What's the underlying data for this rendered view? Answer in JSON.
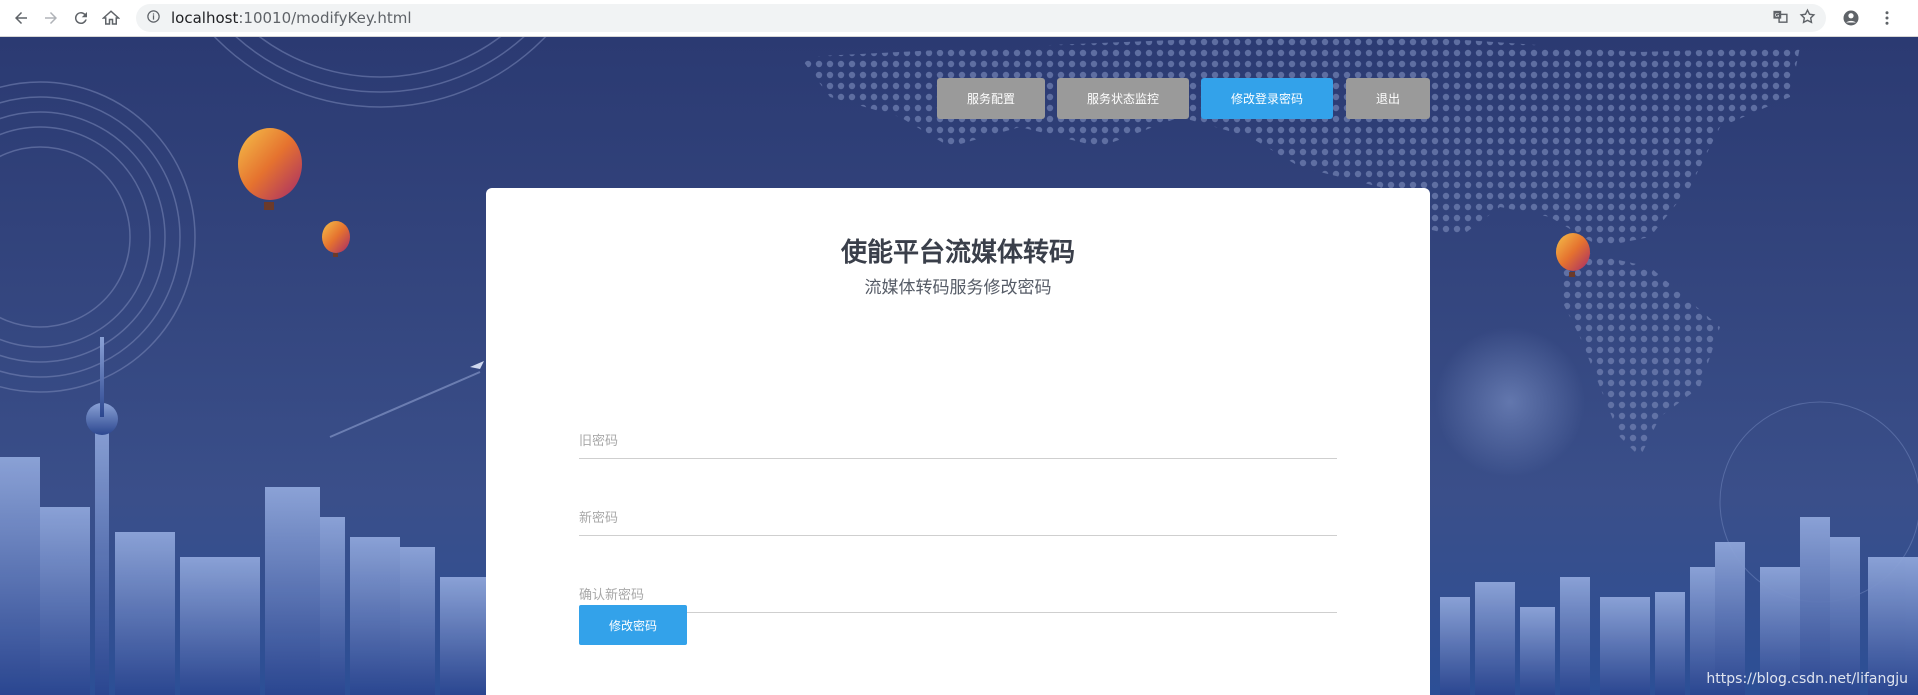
{
  "browser": {
    "url_host": "localhost",
    "url_rest": ":10010/modifyKey.html"
  },
  "topnav": {
    "items": [
      {
        "label": "服务配置",
        "active": false
      },
      {
        "label": "服务状态监控",
        "active": false
      },
      {
        "label": "修改登录密码",
        "active": true
      },
      {
        "label": "退出",
        "active": false
      }
    ]
  },
  "card": {
    "title": "使能平台流媒体转码",
    "subtitle": "流媒体转码服务修改密码",
    "old_password_placeholder": "旧密码",
    "new_password_placeholder": "新密码",
    "confirm_password_placeholder": "确认新密码",
    "submit_label": "修改密码"
  },
  "watermark": "https://blog.csdn.net/lifangju",
  "colors": {
    "accent": "#33a2ea",
    "nav_inactive": "#9a9a9a",
    "background": "#2e3b73"
  }
}
